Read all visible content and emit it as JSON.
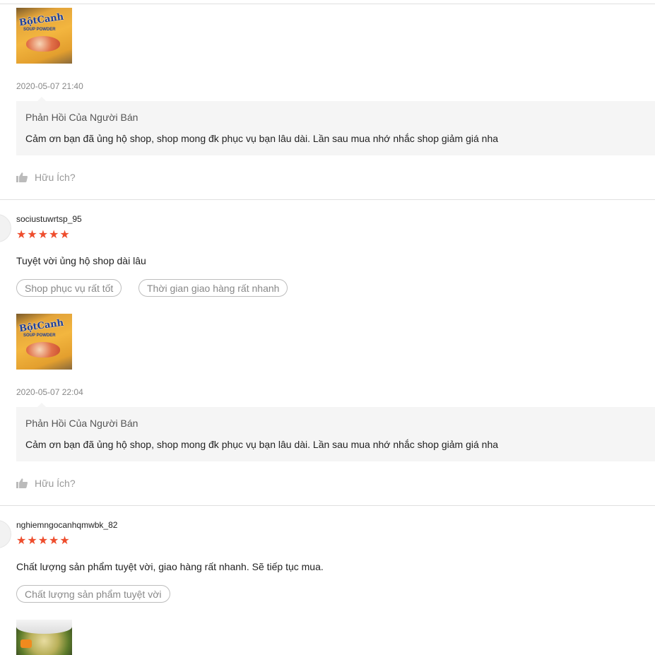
{
  "reviews": [
    {
      "timestamp": "2020-05-07 21:40",
      "thumb_icon": "product-photo-bot-canh",
      "thumb_brand": "BộtCanh",
      "thumb_sub": "SOUP POWDER",
      "seller_reply": {
        "title": "Phản Hồi Của Người Bán",
        "text": "Cảm ơn bạn đã ủng hộ shop, shop mong đk phục vụ bạn lâu dài. Lần sau mua nhớ nhắc shop giảm giá nha"
      },
      "helpful_label": "Hữu Ích?"
    },
    {
      "username": "sociustuwrtsp_95",
      "rating": 5,
      "stars": "★★★★★",
      "text": "Tuyệt vời ủng hộ shop dài lâu",
      "tags": [
        "Shop phục vụ rất tốt",
        "Thời gian giao hàng rất nhanh"
      ],
      "thumb_icon": "product-photo-bot-canh",
      "thumb_brand": "BộtCanh",
      "thumb_sub": "SOUP POWDER",
      "timestamp": "2020-05-07 22:04",
      "seller_reply": {
        "title": "Phản Hồi Của Người Bán",
        "text": "Cảm ơn bạn đã ủng hộ shop, shop mong đk phục vụ bạn lâu dài. Lần sau mua nhớ nhắc shop giảm giá nha"
      },
      "helpful_label": "Hữu Ích?"
    },
    {
      "username": "nghiemngocanhqmwbk_82",
      "rating": 5,
      "stars": "★★★★★",
      "text": "Chất lượng sản phẩm tuyệt vời, giao hàng rất nhanh. Sẽ tiếp tục mua.",
      "tags": [
        "Chất lượng sản phẩm tuyệt vời"
      ],
      "thumb_icon": "soup-photo"
    }
  ],
  "colors": {
    "star": "#ee4d2d",
    "reply_bg": "#f5f5f5",
    "divider": "#e0e0e0",
    "muted": "#888888"
  }
}
